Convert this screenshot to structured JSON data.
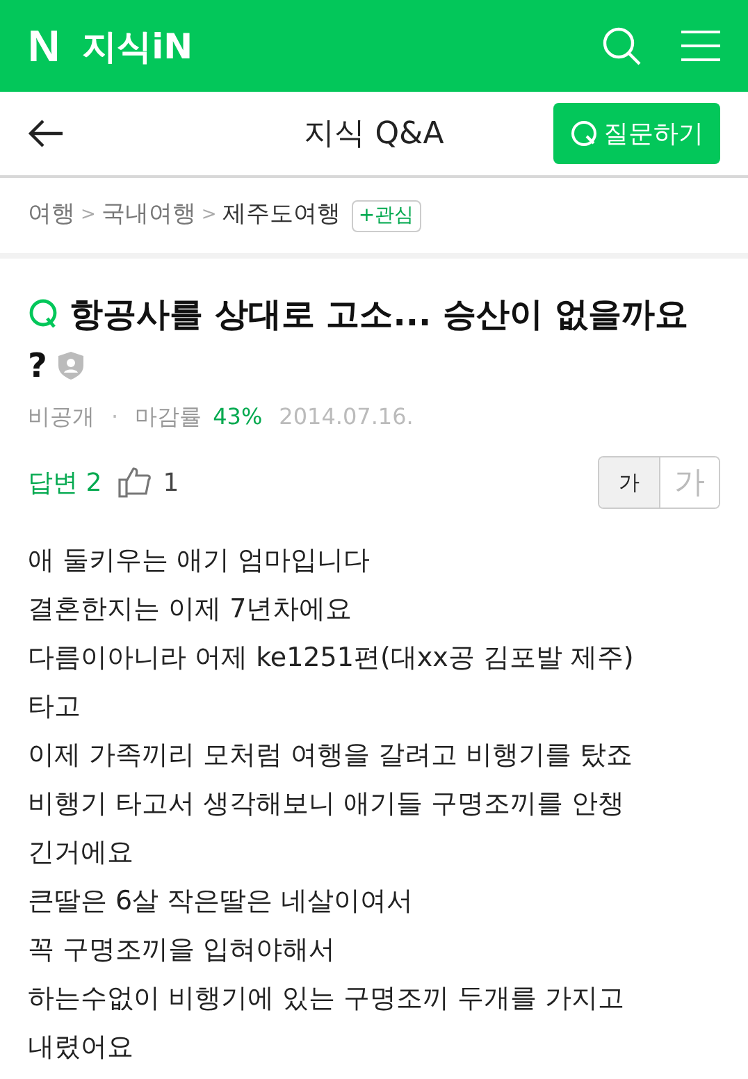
{
  "header": {
    "logo": "N",
    "service": "지식iN"
  },
  "nav": {
    "title": "지식 Q&A",
    "ask_button": "질문하기"
  },
  "breadcrumb": {
    "items": [
      "여행",
      "국내여행",
      "제주도여행"
    ],
    "separator": ">",
    "follow_button": "+관심"
  },
  "question": {
    "title": "항공사를 상대로 고소... 승산이 없을까요",
    "title_end": "?",
    "author": "비공개",
    "dot": "·",
    "close_rate_label": "마감률",
    "close_rate": "43%",
    "date": "2014.07.16."
  },
  "stats": {
    "answers_label": "답변 2",
    "likes": "1"
  },
  "font_sizes": [
    {
      "label": "가",
      "selected": true
    },
    {
      "label": "가",
      "selected": false
    }
  ],
  "body_lines": [
    "애 둘키우는 애기 엄마입니다",
    "결혼한지는 이제 7년차에요",
    "다름이아니라 어제 ke1251편(대xx공 김포발 제주)",
    "타고",
    "이제 가족끼리 모처럼 여행을 갈려고 비행기를 탔죠",
    "비행기 타고서 생각해보니 애기들 구명조끼를 안챙",
    "긴거에요",
    "큰딸은 6살 작은딸은 네살이여서",
    "꼭 구명조끼을 입혀야해서",
    "하는수없이 비행기에 있는 구명조끼 두개를 가지고",
    "내렸어요"
  ]
}
